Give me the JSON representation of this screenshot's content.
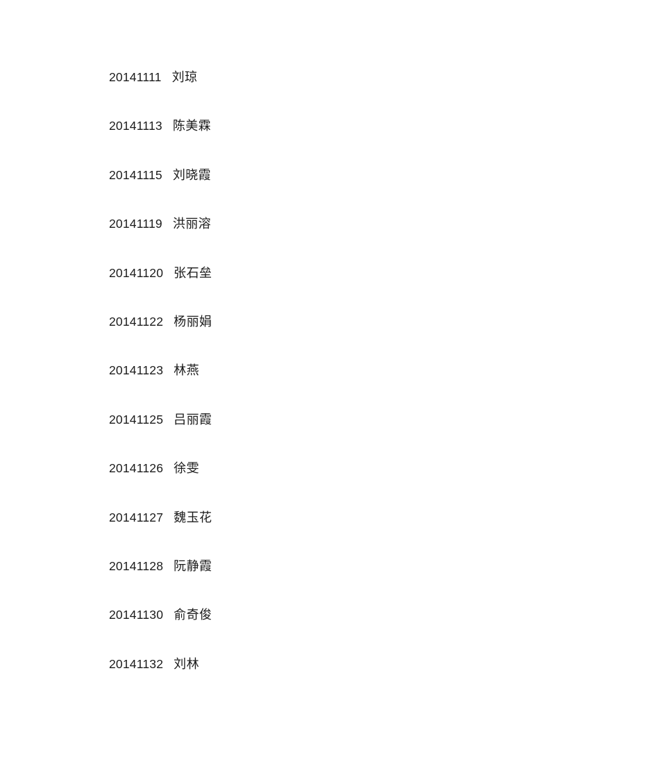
{
  "document": {
    "type": "name-roster",
    "background_color": "#ffffff",
    "text_color": "#1b1b1b",
    "header_text": "",
    "footer_text": "",
    "entries": [
      {
        "id": "20141111",
        "name": "刘琼"
      },
      {
        "id": "20141113",
        "name": "陈美霖"
      },
      {
        "id": "20141115",
        "name": "刘晓霞"
      },
      {
        "id": "20141119",
        "name": "洪丽溶"
      },
      {
        "id": "20141120",
        "name": "张石垒"
      },
      {
        "id": "20141122",
        "name": "杨丽娟"
      },
      {
        "id": "20141123",
        "name": "林燕"
      },
      {
        "id": "20141125",
        "name": "吕丽霞"
      },
      {
        "id": "20141126",
        "name": "徐雯"
      },
      {
        "id": "20141127",
        "name": "魏玉花"
      },
      {
        "id": "20141128",
        "name": "阮静霞"
      },
      {
        "id": "20141130",
        "name": "俞奇俊"
      },
      {
        "id": "20141132",
        "name": "刘林"
      }
    ]
  }
}
